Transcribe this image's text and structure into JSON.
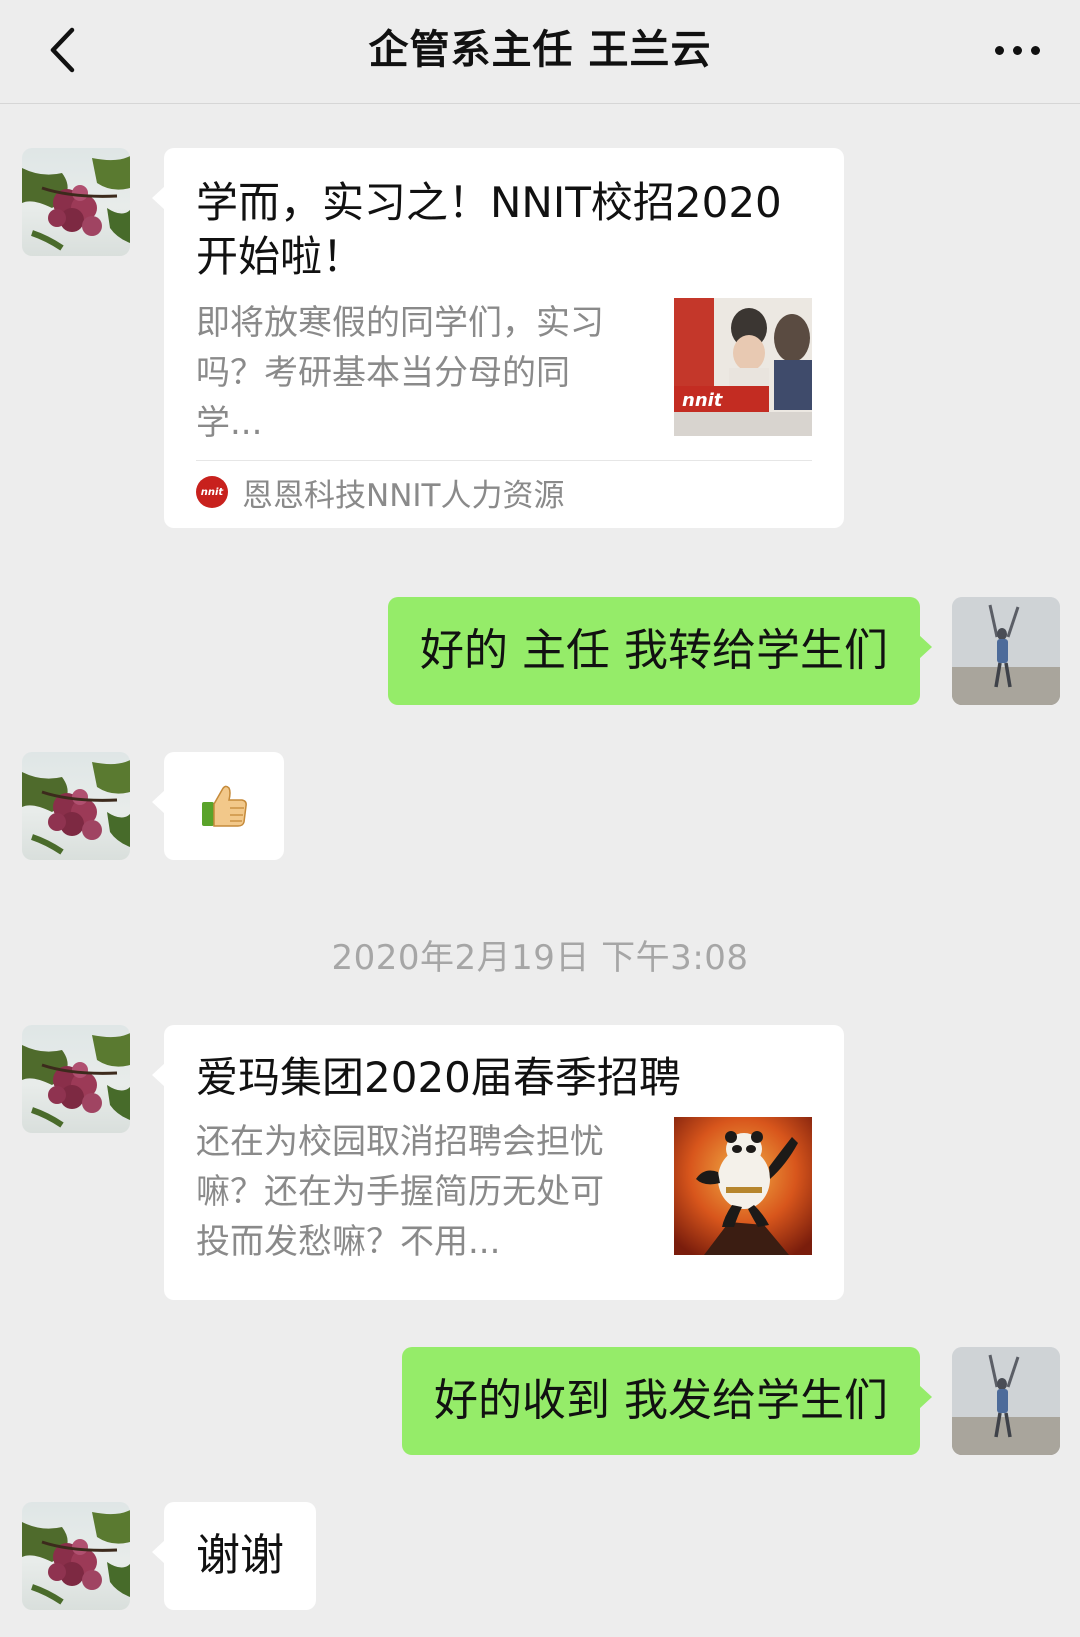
{
  "header": {
    "title": "企管系主任 王兰云",
    "back_icon": "chevron-left-icon",
    "more_icon": "ellipsis-icon"
  },
  "messages": [
    {
      "type": "article",
      "sender": "other",
      "title": "学而，实习之！NNIT校招2020开始啦！",
      "description": "即将放寒假的同学们，实习吗？考研基本当分母的同学...",
      "source": "恩恩科技NNIT人力资源",
      "source_logo_text": "nnit",
      "thumb_text": "nnit"
    },
    {
      "type": "text",
      "sender": "self",
      "text": "好的  主任 我转给学生们"
    },
    {
      "type": "emoji",
      "sender": "other",
      "emoji": "thumbs-up-icon"
    },
    {
      "type": "timestamp",
      "text": "2020年2月19日 下午3:08"
    },
    {
      "type": "article",
      "sender": "other",
      "title": "爱玛集团2020届春季招聘",
      "description": "还在为校园取消招聘会担忧嘛？还在为手握简历无处可投而发愁嘛？不用..."
    },
    {
      "type": "text",
      "sender": "self",
      "text": "好的收到 我发给学生们"
    },
    {
      "type": "text",
      "sender": "other",
      "text": "谢谢"
    }
  ],
  "colors": {
    "background": "#ededed",
    "self_bubble": "#95ec69",
    "other_bubble": "#ffffff",
    "source_logo": "#c8211d"
  }
}
